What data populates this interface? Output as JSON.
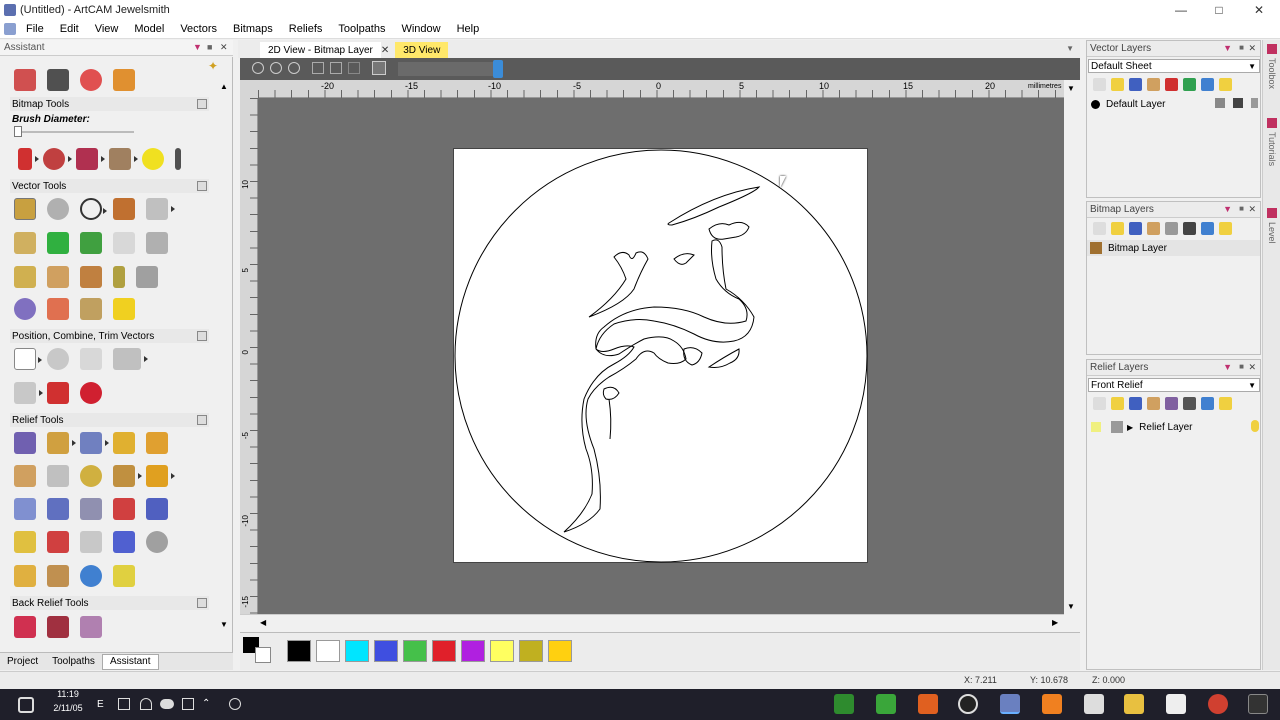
{
  "window": {
    "title": "(Untitled) - ArtCAM Jewelsmith"
  },
  "menu": [
    "File",
    "Edit",
    "View",
    "Model",
    "Vectors",
    "Bitmaps",
    "Reliefs",
    "Toolpaths",
    "Window",
    "Help"
  ],
  "assistant": {
    "header": "Assistant",
    "sections": {
      "bitmap": "Bitmap Tools",
      "brush_label": "Brush Diameter:",
      "vector": "Vector Tools",
      "pctv": "Position, Combine, Trim Vectors",
      "relief": "Relief Tools",
      "back_relief": "Back Relief Tools"
    },
    "bottom_tabs": [
      "Project",
      "Toolpaths",
      "Assistant"
    ]
  },
  "view": {
    "tabs": [
      "2D View - Bitmap Layer",
      "3D View"
    ],
    "ruler_top": [
      "-20",
      "-15",
      "-10",
      "-5",
      "0",
      "5",
      "10",
      "15",
      "20"
    ],
    "ruler_left": [
      "10",
      "5",
      "0",
      "-5",
      "-10",
      "-15"
    ],
    "units": "millimetres"
  },
  "palette": [
    "#000000",
    "#ffffff",
    "#00e5ff",
    "#3f4fe0",
    "#45c04a",
    "#e0202a",
    "#b020e0",
    "#ffff60",
    "#c0b020",
    "#ffd010"
  ],
  "vector_layers": {
    "header": "Vector Layers",
    "sheet": "Default Sheet",
    "layer": "Default Layer"
  },
  "bitmap_layers": {
    "header": "Bitmap Layers",
    "layer": "Bitmap Layer"
  },
  "relief_layers": {
    "header": "Relief Layers",
    "combo": "Front Relief",
    "layer": "Relief Layer"
  },
  "side_strip": [
    "Toolbox",
    "Tutorials",
    "Level"
  ],
  "status": {
    "x": "X: 7.211",
    "y": "Y: 10.678",
    "z": "Z: 0.000"
  },
  "taskbar": {
    "time": "11:19",
    "date": "2/11/05"
  }
}
